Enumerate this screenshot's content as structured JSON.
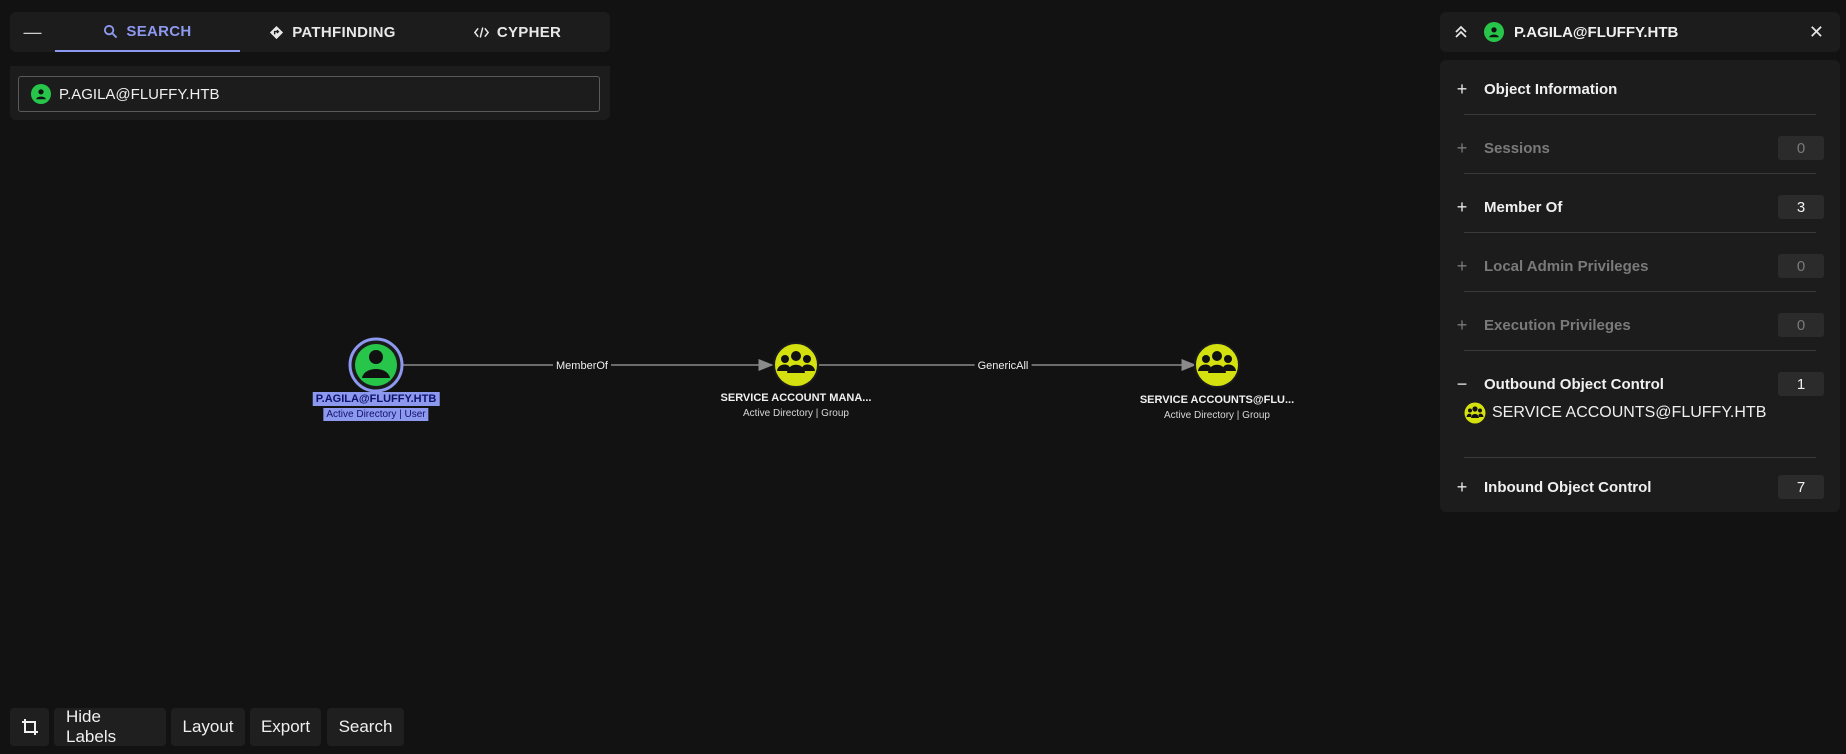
{
  "tabs": {
    "collapse_icon": "minus-icon",
    "items": [
      {
        "label": "SEARCH",
        "icon": "search-icon",
        "active": true
      },
      {
        "label": "PATHFINDING",
        "icon": "pathfinding-icon",
        "active": false
      },
      {
        "label": "CYPHER",
        "icon": "code-icon",
        "active": false
      }
    ]
  },
  "search": {
    "value": "P.AGILA@FLUFFY.HTB"
  },
  "graph": {
    "nodes": [
      {
        "name": "P.AGILA@FLUFFY.HTB",
        "type": "Active Directory | User",
        "kind": "user",
        "selected": true
      },
      {
        "name": "SERVICE ACCOUNT MANA...",
        "type": "Active Directory | Group",
        "kind": "group",
        "selected": false
      },
      {
        "name": "SERVICE ACCOUNTS@FLU...",
        "type": "Active Directory | Group",
        "kind": "group",
        "selected": false
      }
    ],
    "edges": [
      {
        "label": "MemberOf"
      },
      {
        "label": "GenericAll"
      }
    ],
    "colors": {
      "user": "#27c54a",
      "group": "#d4e10f",
      "selected": "#8d98ef"
    }
  },
  "panel": {
    "title": "P.AGILA@FLUFFY.HTB",
    "sections": [
      {
        "label": "Object Information",
        "count": "",
        "expanded": false,
        "dim": false
      },
      {
        "label": "Sessions",
        "count": "0",
        "expanded": false,
        "dim": true
      },
      {
        "label": "Member Of",
        "count": "3",
        "expanded": false,
        "dim": false
      },
      {
        "label": "Local Admin Privileges",
        "count": "0",
        "expanded": false,
        "dim": true
      },
      {
        "label": "Execution Privileges",
        "count": "0",
        "expanded": false,
        "dim": true
      },
      {
        "label": "Outbound Object Control",
        "count": "1",
        "expanded": true,
        "dim": false
      },
      {
        "label": "Inbound Object Control",
        "count": "7",
        "expanded": false,
        "dim": false
      }
    ],
    "outbound_items": [
      "SERVICE ACCOUNTS@FLUFFY.HTB"
    ]
  },
  "toolbar": {
    "crop_icon": "crop-icon",
    "hide_labels": "Hide Labels",
    "layout": "Layout",
    "export": "Export",
    "search": "Search"
  }
}
